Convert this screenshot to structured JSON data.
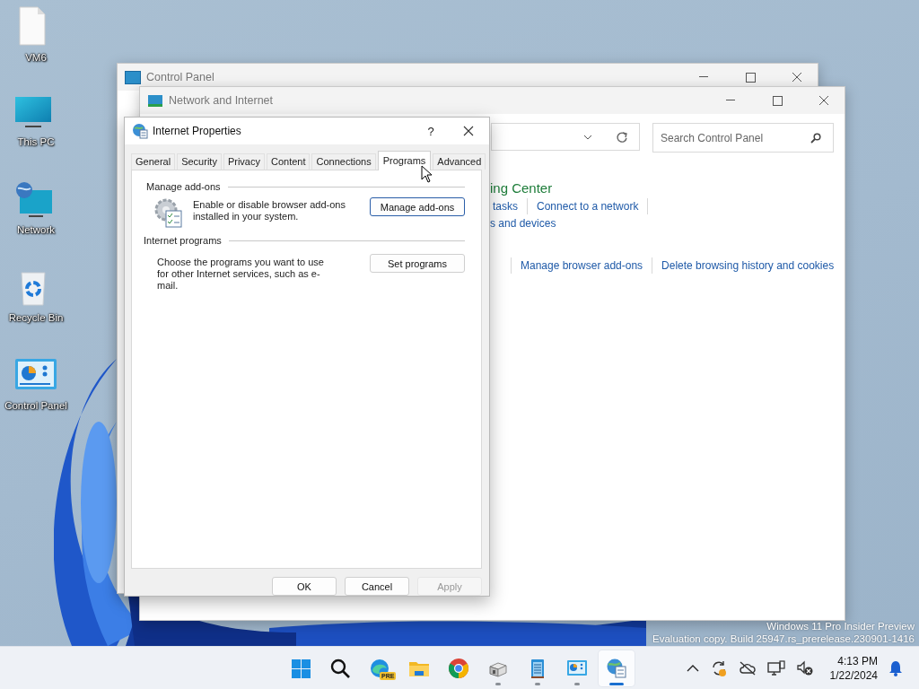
{
  "desktop_icons": [
    {
      "kind": "file",
      "label": "VM6"
    },
    {
      "kind": "monitor",
      "label": "This PC"
    },
    {
      "kind": "network",
      "label": "Network"
    },
    {
      "kind": "recycle",
      "label": "Recycle Bin"
    },
    {
      "kind": "control",
      "label": "Control Panel"
    }
  ],
  "control_panel_window": {
    "title": "Control Panel"
  },
  "network_window": {
    "title": "Network and Internet",
    "search": {
      "placeholder": "Search Control Panel"
    },
    "heading": "ing Center",
    "link_rows": [
      [
        "tasks",
        "Connect to a network"
      ],
      [
        "s and devices"
      ],
      [
        "Manage browser add-ons",
        "Delete browsing history and cookies"
      ]
    ]
  },
  "dialog": {
    "title": "Internet Properties",
    "help": "?",
    "tabs": [
      {
        "label": "General",
        "selected": false
      },
      {
        "label": "Security",
        "selected": false
      },
      {
        "label": "Privacy",
        "selected": false
      },
      {
        "label": "Content",
        "selected": false
      },
      {
        "label": "Connections",
        "selected": false
      },
      {
        "label": "Programs",
        "selected": true
      },
      {
        "label": "Advanced",
        "selected": false
      }
    ],
    "groups": [
      {
        "legend": "Manage add-ons",
        "kind": "addons",
        "text": "Enable or disable browser add-ons installed in your system.",
        "button": "Manage add-ons",
        "default": true
      },
      {
        "legend": "Internet programs",
        "kind": "plain",
        "text": "Choose the programs you want to use for other Internet services, such as e-mail.",
        "button": "Set programs",
        "default": false
      }
    ],
    "buttons": [
      {
        "label": "OK",
        "disabled": false
      },
      {
        "label": "Cancel",
        "disabled": false
      },
      {
        "label": "Apply",
        "disabled": true
      }
    ]
  },
  "watermark": [
    "Windows 11 Pro Insider Preview",
    "Evaluation copy. Build 25947.rs_prerelease.230901-1416"
  ],
  "taskbar": {
    "apps": [
      {
        "kind": "start",
        "running": false,
        "selected": false
      },
      {
        "kind": "search",
        "running": false,
        "selected": false
      },
      {
        "kind": "edge",
        "badge": "PRE",
        "running": false,
        "selected": false
      },
      {
        "kind": "folder",
        "running": false,
        "selected": false
      },
      {
        "kind": "chrome",
        "running": false,
        "selected": false
      },
      {
        "kind": "devices",
        "running": true,
        "selected": false
      },
      {
        "kind": "notepad",
        "running": true,
        "selected": false
      },
      {
        "kind": "control",
        "running": true,
        "selected": false
      },
      {
        "kind": "inetprops",
        "running": true,
        "selected": true
      }
    ],
    "time": "4:13 PM",
    "date": "1/22/2024"
  }
}
